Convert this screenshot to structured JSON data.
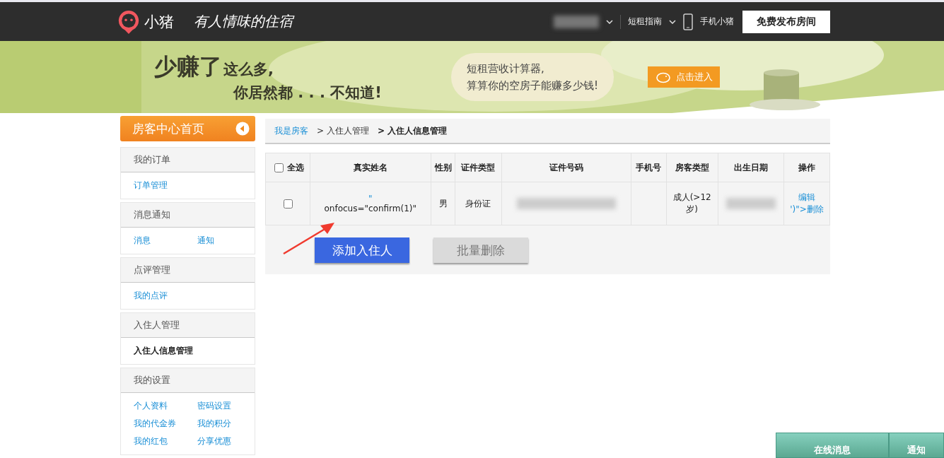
{
  "header": {
    "logo_text": "小猪",
    "slogan": "有人情味的住宿",
    "nav": [
      {
        "label": "短租指南",
        "kind": "dropdown"
      },
      {
        "label": "手机小猪",
        "kind": "phone"
      }
    ],
    "publish_button": "免费发布房间"
  },
  "banner": {
    "headline_big": "少赚了",
    "headline_small": "这么多,",
    "line2": "你居然都 . . . 不知道!",
    "bubble_lines": [
      "短租营收计算器,",
      "算算你的空房子能赚多少钱!"
    ],
    "cta": "点击进入"
  },
  "sidebar": {
    "home": "房客中心首页",
    "sections": [
      {
        "title": "我的订单",
        "items": [
          {
            "label": "订单管理",
            "selected": false
          }
        ]
      },
      {
        "title": "消息通知",
        "items": [
          {
            "label": "消息",
            "selected": false
          },
          {
            "label": "通知",
            "selected": false
          }
        ]
      },
      {
        "title": "点评管理",
        "items": [
          {
            "label": "我的点评",
            "selected": false
          }
        ]
      },
      {
        "title": "入住人管理",
        "items": [
          {
            "label": "入住人信息管理",
            "selected": true
          }
        ]
      },
      {
        "title": "我的设置",
        "items": [
          {
            "label": "个人资料",
            "selected": false
          },
          {
            "label": "密码设置",
            "selected": false
          },
          {
            "label": "我的代金券",
            "selected": false
          },
          {
            "label": "我的积分",
            "selected": false
          },
          {
            "label": "我的红包",
            "selected": false
          },
          {
            "label": "分享优惠",
            "selected": false
          }
        ]
      }
    ]
  },
  "breadcrumb": [
    {
      "label": "我是房客",
      "kind": "link"
    },
    {
      "label": "> 入住人管理",
      "kind": "plain"
    },
    {
      "label": "> 入住人信息管理",
      "kind": "current"
    }
  ],
  "table": {
    "select_all": {
      "label": "全选",
      "checked": false
    },
    "columns": [
      "真实姓名",
      "性别",
      "证件类型",
      "证件号码",
      "手机号",
      "房客类型",
      "出生日期",
      "操作"
    ],
    "rows": [
      {
        "checked": false,
        "name_lines": [
          "\"",
          "onfocus=\"confirm(1)\""
        ],
        "gender": "男",
        "id_type": "身份证",
        "guest_type_lines": [
          "成人(>12",
          "岁)"
        ],
        "actions": [
          "编辑",
          "')\">删除"
        ]
      }
    ]
  },
  "buttons": [
    {
      "label": "添加入住人",
      "disabled": false
    },
    {
      "label": "批量删除",
      "disabled": true
    }
  ],
  "chat_bar": [
    "在线消息",
    "通知"
  ]
}
